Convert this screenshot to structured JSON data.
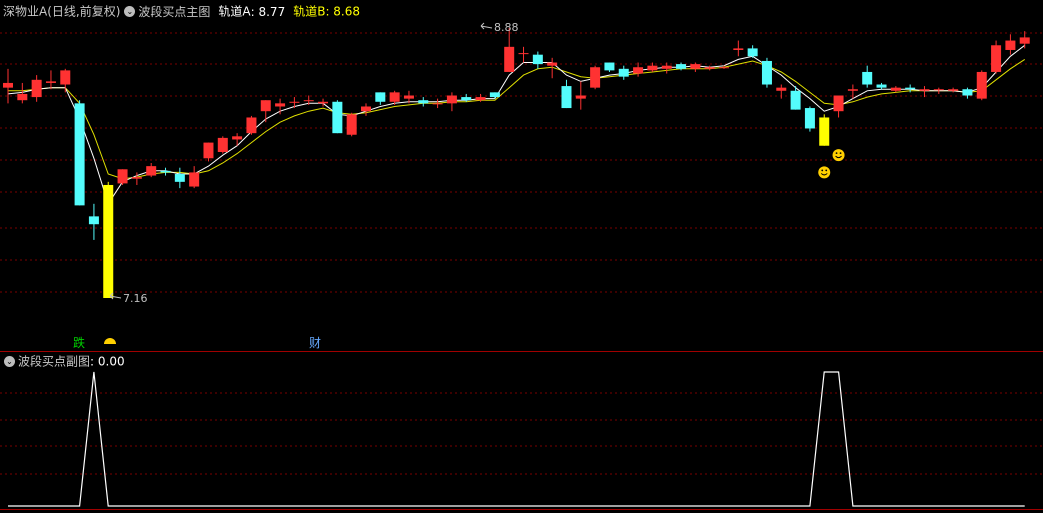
{
  "main_header": {
    "symbol": "深物业A(日线,前复权)",
    "indicator": "波段买点主图",
    "trackA_label": "轨道A",
    "trackA_value": ": 8.77",
    "trackB_label": "轨道B",
    "trackB_value": ": 8.68"
  },
  "sub_header": {
    "indicator": "波段买点副图",
    "value": ": 0.00"
  },
  "annotations": {
    "high": "8.88",
    "low": "7.16",
    "marker_die": "跌",
    "marker_cai": "财"
  },
  "colors": {
    "up": "#ff3232",
    "down": "#54fcfc",
    "signal": "#ffff00",
    "trackA": "#ffffff",
    "trackB": "#e0e000",
    "grid": "#7a0000",
    "border": "#a00000",
    "label": "#c0c0c0"
  },
  "chart_data": {
    "type": "candlestick",
    "price_range": [
      7.16,
      8.88
    ],
    "candles": [
      {
        "o": 8.5,
        "h": 8.62,
        "l": 8.4,
        "c": 8.53,
        "k": "up"
      },
      {
        "o": 8.46,
        "h": 8.53,
        "l": 8.4,
        "c": 8.42,
        "k": "up"
      },
      {
        "o": 8.44,
        "h": 8.58,
        "l": 8.41,
        "c": 8.55,
        "k": "up"
      },
      {
        "o": 8.54,
        "h": 8.61,
        "l": 8.49,
        "c": 8.53,
        "k": "flat"
      },
      {
        "o": 8.61,
        "h": 8.62,
        "l": 8.47,
        "c": 8.52,
        "k": "up"
      },
      {
        "o": 8.4,
        "h": 8.42,
        "l": 7.75,
        "c": 7.75,
        "k": "down"
      },
      {
        "o": 7.68,
        "h": 7.76,
        "l": 7.53,
        "c": 7.63,
        "k": "down"
      },
      {
        "o": 7.88,
        "h": 7.9,
        "l": 7.16,
        "c": 7.16,
        "k": "signal"
      },
      {
        "o": 7.89,
        "h": 7.98,
        "l": 7.88,
        "c": 7.98,
        "k": "up"
      },
      {
        "o": 7.92,
        "h": 7.96,
        "l": 7.88,
        "c": 7.93,
        "k": "flat"
      },
      {
        "o": 7.94,
        "h": 8.02,
        "l": 7.93,
        "c": 8.0,
        "k": "up"
      },
      {
        "o": 7.96,
        "h": 7.99,
        "l": 7.94,
        "c": 7.97,
        "k": "down"
      },
      {
        "o": 7.95,
        "h": 7.99,
        "l": 7.86,
        "c": 7.9,
        "k": "down"
      },
      {
        "o": 7.87,
        "h": 8.0,
        "l": 7.86,
        "c": 7.96,
        "k": "up"
      },
      {
        "o": 8.05,
        "h": 8.15,
        "l": 8.03,
        "c": 8.15,
        "k": "up"
      },
      {
        "o": 8.09,
        "h": 8.19,
        "l": 8.08,
        "c": 8.18,
        "k": "up"
      },
      {
        "o": 8.17,
        "h": 8.21,
        "l": 8.13,
        "c": 8.19,
        "k": "up"
      },
      {
        "o": 8.21,
        "h": 8.32,
        "l": 8.2,
        "c": 8.31,
        "k": "up"
      },
      {
        "o": 8.35,
        "h": 8.42,
        "l": 8.28,
        "c": 8.42,
        "k": "up"
      },
      {
        "o": 8.38,
        "h": 8.43,
        "l": 8.33,
        "c": 8.4,
        "k": "flat"
      },
      {
        "o": 8.41,
        "h": 8.44,
        "l": 8.37,
        "c": 8.41,
        "k": "flat"
      },
      {
        "o": 8.42,
        "h": 8.45,
        "l": 8.39,
        "c": 8.42,
        "k": "flat"
      },
      {
        "o": 8.41,
        "h": 8.43,
        "l": 8.38,
        "c": 8.4,
        "k": "flat"
      },
      {
        "o": 8.41,
        "h": 8.42,
        "l": 8.21,
        "c": 8.21,
        "k": "down"
      },
      {
        "o": 8.2,
        "h": 8.34,
        "l": 8.19,
        "c": 8.33,
        "k": "up"
      },
      {
        "o": 8.35,
        "h": 8.4,
        "l": 8.32,
        "c": 8.38,
        "k": "up"
      },
      {
        "o": 8.47,
        "h": 8.47,
        "l": 8.39,
        "c": 8.41,
        "k": "down"
      },
      {
        "o": 8.41,
        "h": 8.48,
        "l": 8.39,
        "c": 8.47,
        "k": "up"
      },
      {
        "o": 8.45,
        "h": 8.48,
        "l": 8.4,
        "c": 8.43,
        "k": "flat"
      },
      {
        "o": 8.42,
        "h": 8.44,
        "l": 8.38,
        "c": 8.4,
        "k": "down"
      },
      {
        "o": 8.4,
        "h": 8.43,
        "l": 8.37,
        "c": 8.4,
        "k": "flat"
      },
      {
        "o": 8.4,
        "h": 8.47,
        "l": 8.35,
        "c": 8.45,
        "k": "up"
      },
      {
        "o": 8.44,
        "h": 8.46,
        "l": 8.41,
        "c": 8.42,
        "k": "down"
      },
      {
        "o": 8.42,
        "h": 8.46,
        "l": 8.41,
        "c": 8.44,
        "k": "up"
      },
      {
        "o": 8.47,
        "h": 8.47,
        "l": 8.43,
        "c": 8.44,
        "k": "down"
      },
      {
        "o": 8.6,
        "h": 8.88,
        "l": 8.6,
        "c": 8.76,
        "k": "up"
      },
      {
        "o": 8.72,
        "h": 8.76,
        "l": 8.66,
        "c": 8.72,
        "k": "flat"
      },
      {
        "o": 8.71,
        "h": 8.73,
        "l": 8.62,
        "c": 8.65,
        "k": "down"
      },
      {
        "o": 8.64,
        "h": 8.69,
        "l": 8.56,
        "c": 8.66,
        "k": "up"
      },
      {
        "o": 8.51,
        "h": 8.55,
        "l": 8.37,
        "c": 8.37,
        "k": "down"
      },
      {
        "o": 8.43,
        "h": 8.54,
        "l": 8.36,
        "c": 8.45,
        "k": "up"
      },
      {
        "o": 8.5,
        "h": 8.64,
        "l": 8.49,
        "c": 8.63,
        "k": "up"
      },
      {
        "o": 8.66,
        "h": 8.66,
        "l": 8.6,
        "c": 8.61,
        "k": "down"
      },
      {
        "o": 8.62,
        "h": 8.64,
        "l": 8.55,
        "c": 8.57,
        "k": "down"
      },
      {
        "o": 8.59,
        "h": 8.66,
        "l": 8.57,
        "c": 8.63,
        "k": "up"
      },
      {
        "o": 8.64,
        "h": 8.66,
        "l": 8.6,
        "c": 8.61,
        "k": "flat"
      },
      {
        "o": 8.62,
        "h": 8.66,
        "l": 8.59,
        "c": 8.64,
        "k": "flat"
      },
      {
        "o": 8.65,
        "h": 8.66,
        "l": 8.61,
        "c": 8.62,
        "k": "down"
      },
      {
        "o": 8.62,
        "h": 8.66,
        "l": 8.6,
        "c": 8.65,
        "k": "up"
      },
      {
        "o": 8.63,
        "h": 8.64,
        "l": 8.61,
        "c": 8.62,
        "k": "flat"
      },
      {
        "o": 8.63,
        "h": 8.64,
        "l": 8.62,
        "c": 8.63,
        "k": "up"
      },
      {
        "o": 8.74,
        "h": 8.8,
        "l": 8.7,
        "c": 8.75,
        "k": "up"
      },
      {
        "o": 8.75,
        "h": 8.77,
        "l": 8.69,
        "c": 8.7,
        "k": "down"
      },
      {
        "o": 8.67,
        "h": 8.69,
        "l": 8.5,
        "c": 8.52,
        "k": "down"
      },
      {
        "o": 8.48,
        "h": 8.52,
        "l": 8.43,
        "c": 8.5,
        "k": "up"
      },
      {
        "o": 8.48,
        "h": 8.51,
        "l": 8.36,
        "c": 8.36,
        "k": "down"
      },
      {
        "o": 8.37,
        "h": 8.38,
        "l": 8.22,
        "c": 8.24,
        "k": "down"
      },
      {
        "o": 8.31,
        "h": 8.33,
        "l": 8.13,
        "c": 8.13,
        "k": "signal"
      },
      {
        "o": 8.35,
        "h": 8.45,
        "l": 8.31,
        "c": 8.45,
        "k": "up"
      },
      {
        "o": 8.48,
        "h": 8.52,
        "l": 8.43,
        "c": 8.49,
        "k": "flat"
      },
      {
        "o": 8.6,
        "h": 8.64,
        "l": 8.5,
        "c": 8.52,
        "k": "down"
      },
      {
        "o": 8.52,
        "h": 8.53,
        "l": 8.49,
        "c": 8.5,
        "k": "down"
      },
      {
        "o": 8.5,
        "h": 8.51,
        "l": 8.47,
        "c": 8.48,
        "k": "flat"
      },
      {
        "o": 8.49,
        "h": 8.52,
        "l": 8.47,
        "c": 8.5,
        "k": "down"
      },
      {
        "o": 8.49,
        "h": 8.51,
        "l": 8.44,
        "c": 8.48,
        "k": "up"
      },
      {
        "o": 8.49,
        "h": 8.5,
        "l": 8.46,
        "c": 8.49,
        "k": "flat"
      },
      {
        "o": 8.49,
        "h": 8.5,
        "l": 8.47,
        "c": 8.48,
        "k": "flat"
      },
      {
        "o": 8.49,
        "h": 8.5,
        "l": 8.43,
        "c": 8.45,
        "k": "down"
      },
      {
        "o": 8.43,
        "h": 8.61,
        "l": 8.42,
        "c": 8.6,
        "k": "up"
      },
      {
        "o": 8.6,
        "h": 8.8,
        "l": 8.59,
        "c": 8.77,
        "k": "up"
      },
      {
        "o": 8.74,
        "h": 8.84,
        "l": 8.71,
        "c": 8.8,
        "k": "up"
      },
      {
        "o": 8.78,
        "h": 8.86,
        "l": 8.75,
        "c": 8.82,
        "k": "up"
      }
    ],
    "track_a": [
      8.46,
      8.47,
      8.49,
      8.5,
      8.5,
      8.3,
      8.05,
      7.76,
      7.9,
      7.94,
      7.97,
      7.97,
      7.95,
      7.95,
      8.0,
      8.07,
      8.13,
      8.22,
      8.3,
      8.35,
      8.38,
      8.4,
      8.4,
      8.33,
      8.32,
      8.35,
      8.38,
      8.4,
      8.41,
      8.41,
      8.41,
      8.42,
      8.42,
      8.43,
      8.43,
      8.58,
      8.66,
      8.66,
      8.66,
      8.58,
      8.54,
      8.56,
      8.58,
      8.59,
      8.61,
      8.62,
      8.63,
      8.63,
      8.64,
      8.63,
      8.64,
      8.68,
      8.7,
      8.64,
      8.58,
      8.5,
      8.43,
      8.35,
      8.38,
      8.43,
      8.48,
      8.49,
      8.49,
      8.49,
      8.48,
      8.48,
      8.48,
      8.47,
      8.5,
      8.6,
      8.7,
      8.77
    ],
    "track_b": [
      8.48,
      8.48,
      8.49,
      8.5,
      8.5,
      8.4,
      8.2,
      7.95,
      7.92,
      7.93,
      7.95,
      7.96,
      7.96,
      7.95,
      7.97,
      8.02,
      8.08,
      8.15,
      8.22,
      8.28,
      8.32,
      8.35,
      8.37,
      8.34,
      8.33,
      8.34,
      8.36,
      8.38,
      8.39,
      8.4,
      8.4,
      8.41,
      8.41,
      8.42,
      8.42,
      8.5,
      8.58,
      8.62,
      8.63,
      8.6,
      8.57,
      8.56,
      8.57,
      8.58,
      8.59,
      8.6,
      8.61,
      8.62,
      8.62,
      8.62,
      8.63,
      8.65,
      8.67,
      8.64,
      8.6,
      8.54,
      8.47,
      8.4,
      8.39,
      8.41,
      8.44,
      8.46,
      8.47,
      8.48,
      8.48,
      8.48,
      8.48,
      8.47,
      8.48,
      8.55,
      8.62,
      8.68
    ],
    "smile_markers": [
      {
        "index": 58,
        "price": 8.07
      },
      {
        "index": 57,
        "price": 7.96
      }
    ],
    "sub_indicator": {
      "values": [
        0,
        0,
        0,
        0,
        0,
        0,
        1,
        0,
        0,
        0,
        0,
        0,
        0,
        0,
        0,
        0,
        0,
        0,
        0,
        0,
        0,
        0,
        0,
        0,
        0,
        0,
        0,
        0,
        0,
        0,
        0,
        0,
        0,
        0,
        0,
        0,
        0,
        0,
        0,
        0,
        0,
        0,
        0,
        0,
        0,
        0,
        0,
        0,
        0,
        0,
        0,
        0,
        0,
        0,
        0,
        0,
        0,
        1,
        1,
        0,
        0,
        0,
        0,
        0,
        0,
        0,
        0,
        0,
        0,
        0,
        0,
        0
      ],
      "current": 0.0
    }
  }
}
